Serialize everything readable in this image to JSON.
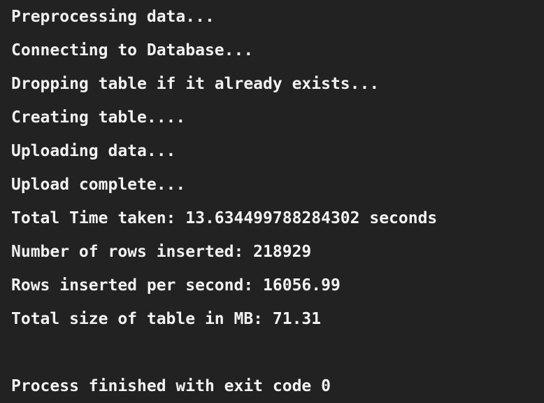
{
  "console": {
    "lines": [
      "Preprocessing data...",
      "Connecting to Database...",
      "Dropping table if it already exists...",
      "Creating table....",
      "Uploading data...",
      "Upload complete...",
      "Total Time taken: 13.634499788284302 seconds",
      "Number of rows inserted: 218929",
      "Rows inserted per second: 16056.99",
      "Total size of table in MB: 71.31",
      "",
      "Process finished with exit code 0"
    ]
  },
  "colors": {
    "background": "#222222",
    "text": "#f2f2f2"
  }
}
